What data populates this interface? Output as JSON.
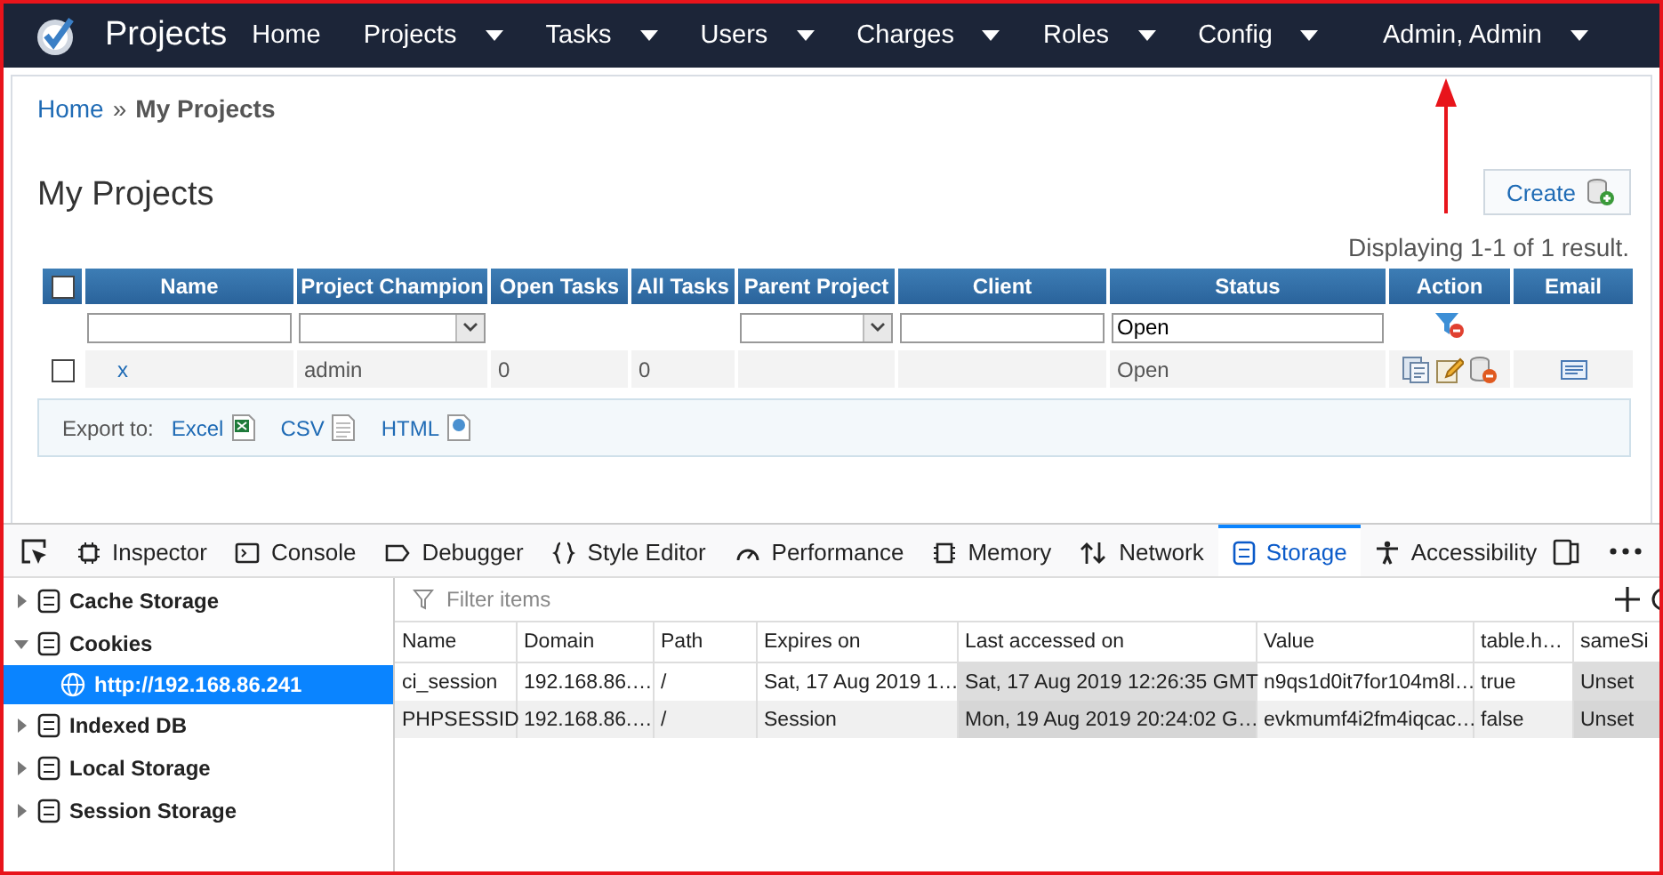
{
  "navbar": {
    "brand": "Projects",
    "items": [
      {
        "label": "Home",
        "dropdown": false
      },
      {
        "label": "Projects",
        "dropdown": true
      },
      {
        "label": "Tasks",
        "dropdown": true
      },
      {
        "label": "Users",
        "dropdown": true
      },
      {
        "label": "Charges",
        "dropdown": true
      },
      {
        "label": "Roles",
        "dropdown": true
      },
      {
        "label": "Config",
        "dropdown": true
      },
      {
        "label": "Admin, Admin",
        "dropdown": true
      }
    ]
  },
  "breadcrumb": {
    "links": [
      "Home"
    ],
    "separator": "»",
    "current": "My Projects"
  },
  "page_title": "My Projects",
  "create_button": "Create",
  "summary": "Displaying 1-1 of 1 result.",
  "grid": {
    "select_all_checked": false,
    "columns": [
      "Name",
      "Project Champion",
      "Open Tasks",
      "All Tasks",
      "Parent Project",
      "Client",
      "Status",
      "Action",
      "Email"
    ],
    "filters": [
      {
        "kind": "text"
      },
      {
        "kind": "select"
      },
      {
        "kind": "none"
      },
      {
        "kind": "none"
      },
      {
        "kind": "select"
      },
      {
        "kind": "text"
      },
      {
        "kind": "text",
        "value": "Open"
      },
      {
        "kind": "clear"
      },
      {
        "kind": "none"
      }
    ],
    "rows": [
      {
        "checked": false,
        "name": "x",
        "champion": "admin",
        "open_tasks": "0",
        "all_tasks": "0",
        "parent": "",
        "client": "",
        "status": "Open"
      }
    ]
  },
  "export": {
    "label": "Export to:",
    "links": [
      {
        "label": "Excel",
        "kind": "excel"
      },
      {
        "label": "CSV",
        "kind": "csv"
      },
      {
        "label": "HTML",
        "kind": "html"
      }
    ]
  },
  "devtools": {
    "tabs": [
      {
        "label": "Inspector",
        "kind": "inspector",
        "selected": false
      },
      {
        "label": "Console",
        "kind": "console",
        "selected": false
      },
      {
        "label": "Debugger",
        "kind": "debugger",
        "selected": false
      },
      {
        "label": "Style Editor",
        "kind": "style",
        "selected": false
      },
      {
        "label": "Performance",
        "kind": "performance",
        "selected": false
      },
      {
        "label": "Memory",
        "kind": "memory",
        "selected": false
      },
      {
        "label": "Network",
        "kind": "network",
        "selected": false
      },
      {
        "label": "Storage",
        "kind": "storage",
        "selected": true
      },
      {
        "label": "Accessibility",
        "kind": "accessibility",
        "selected": false
      }
    ],
    "sidebar": [
      {
        "label": "Cache Storage",
        "expanded": false
      },
      {
        "label": "Cookies",
        "expanded": true,
        "children": [
          {
            "label": "http://192.168.86.241",
            "selected": true
          }
        ]
      },
      {
        "label": "Indexed DB",
        "expanded": false
      },
      {
        "label": "Local Storage",
        "expanded": false
      },
      {
        "label": "Session Storage",
        "expanded": false
      }
    ],
    "filter": {
      "placeholder": "Filter items"
    },
    "table": {
      "columns": [
        {
          "label": "Name",
          "shaded": false
        },
        {
          "label": "Domain",
          "shaded": false
        },
        {
          "label": "Path",
          "shaded": false
        },
        {
          "label": "Expires on",
          "shaded": false
        },
        {
          "label": "Last accessed on",
          "shaded": true
        },
        {
          "label": "Value",
          "shaded": false
        },
        {
          "label": "table.h…",
          "shaded": false
        },
        {
          "label": "sameSi",
          "shaded": true
        }
      ],
      "rows": [
        {
          "cells": [
            "ci_session",
            "192.168.86.…",
            "/",
            "Sat, 17 Aug 2019 1…",
            "Sat, 17 Aug 2019 12:26:35 GMT",
            "n9qs1d0it7for104m8l…",
            "true",
            "Unset"
          ]
        },
        {
          "cells": [
            "PHPSESSID",
            "192.168.86.…",
            "/",
            "Session",
            "Mon, 19 Aug 2019 20:24:02 G…",
            "evkmumf4i2fm4iqcac…",
            "false",
            "Unset"
          ]
        }
      ]
    }
  }
}
